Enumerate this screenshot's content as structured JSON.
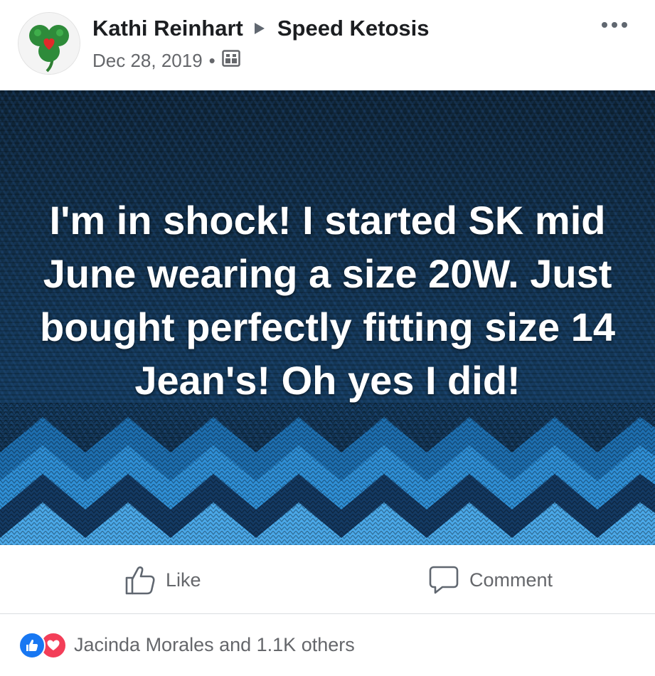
{
  "post": {
    "author": "Kathi Reinhart",
    "group": "Speed Ketosis",
    "date": "Dec 28, 2019",
    "separator": "•",
    "audience_icon": "group-audience-icon",
    "avatar_icon": "shamrock-heart-icon",
    "more_icon": "more-options-icon"
  },
  "image": {
    "text": "I'm in shock! I started SK mid June wearing a size 20W. Just bought perfectly fitting size 14 Jean's! Oh yes I did!",
    "background": "blue-knit-sweater-pattern"
  },
  "actions": {
    "like_label": "Like",
    "comment_label": "Comment",
    "like_icon": "thumbs-up-icon",
    "comment_icon": "speech-bubble-icon"
  },
  "reactions": {
    "summary": "Jacinda Morales and 1.1K others",
    "icons": [
      "like-reaction-icon",
      "love-reaction-icon"
    ]
  },
  "colors": {
    "like_blue": "#1877f2",
    "love_red": "#f33e58",
    "secondary_text": "#65676b",
    "primary_text": "#1c1e21"
  }
}
